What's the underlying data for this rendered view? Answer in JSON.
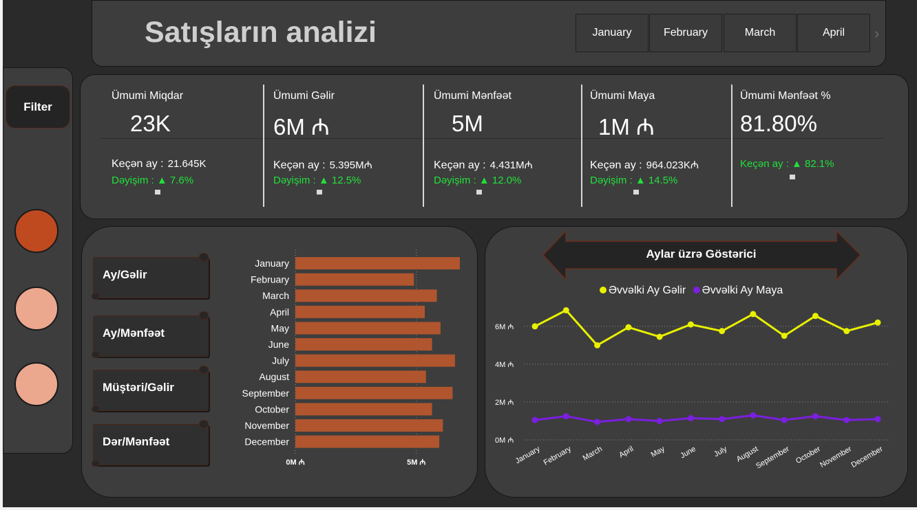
{
  "header": {
    "title": "Satışların analizi",
    "months": [
      "January",
      "February",
      "March",
      "April"
    ]
  },
  "sidebar": {
    "filter_label": "Filter",
    "slicer_colors": [
      "#bf4a1f",
      "#eca88f",
      "#eca88f"
    ]
  },
  "kpis": [
    {
      "label": "Ümumi Miqdar",
      "value": "23K",
      "prev_label": "Keçən ay :",
      "prev_value": "21.645K",
      "change": "Dəyişim :  ▲  7.6%"
    },
    {
      "label": "Ümumi Gəlir",
      "value": "6M ₼",
      "prev_label": "Keçən ay :",
      "prev_value": "5.395M₼",
      "change": "Dəyişim :  ▲ 12.5%"
    },
    {
      "label": "Ümumi Mənfəət",
      "value": "5M",
      "prev_label": "Keçən ay :",
      "prev_value": "4.431M₼",
      "change": "Dəyişim :  ▲ 12.0%"
    },
    {
      "label": "Ümumi Maya",
      "value": "1M ₼",
      "prev_label": "Keçən ay :",
      "prev_value": "964.023K₼",
      "change": "Dəyişim :  ▲ 14.5%"
    },
    {
      "label": "Ümumi Mənfəət %",
      "value": "81.80%",
      "prev_label": "",
      "prev_value": "",
      "change": "Keçən ay : ▲ 82.1%"
    }
  ],
  "bar_buttons": [
    "Ay/Gəlir",
    "Ay/Mənfəət",
    "Müştəri/Gəlir",
    "Dər/Mənfəət"
  ],
  "line_panel": {
    "banner": "Aylar üzrə Göstərici"
  },
  "colors": {
    "bar": "#b0552e",
    "accent": "#bf4a1f",
    "positive": "#22e03a",
    "line_income": "#e8f000",
    "line_cost": "#7b1fe0"
  },
  "chart_data": [
    {
      "type": "bar",
      "orientation": "horizontal",
      "categories": [
        "January",
        "February",
        "March",
        "April",
        "May",
        "June",
        "July",
        "August",
        "September",
        "October",
        "November",
        "December"
      ],
      "values": [
        6.8,
        4.9,
        5.85,
        5.35,
        6.0,
        5.65,
        6.6,
        5.4,
        6.5,
        5.65,
        6.1,
        5.95
      ],
      "x_ticks": [
        "0M ₼",
        "5M ₼"
      ],
      "xlim": [
        0,
        7
      ],
      "grid": true
    },
    {
      "type": "line",
      "categories": [
        "January",
        "February",
        "March",
        "April",
        "May",
        "June",
        "July",
        "August",
        "September",
        "October",
        "November",
        "December"
      ],
      "series": [
        {
          "name": "Əvvəlki Ay Gəlir",
          "color": "#e8f000",
          "values": [
            6.0,
            6.85,
            5.0,
            5.95,
            5.45,
            6.1,
            5.75,
            6.65,
            5.5,
            6.55,
            5.75,
            6.2
          ]
        },
        {
          "name": "Əvvəlki Ay Maya",
          "color": "#7b1fe0",
          "values": [
            1.05,
            1.25,
            0.95,
            1.1,
            1.0,
            1.15,
            1.1,
            1.3,
            1.05,
            1.25,
            1.05,
            1.1
          ]
        }
      ],
      "y_ticks": [
        "0M ₼",
        "2M ₼",
        "4M ₼",
        "6M ₼"
      ],
      "ylim": [
        0,
        7.3
      ],
      "legend_position": "top",
      "grid": true
    }
  ]
}
